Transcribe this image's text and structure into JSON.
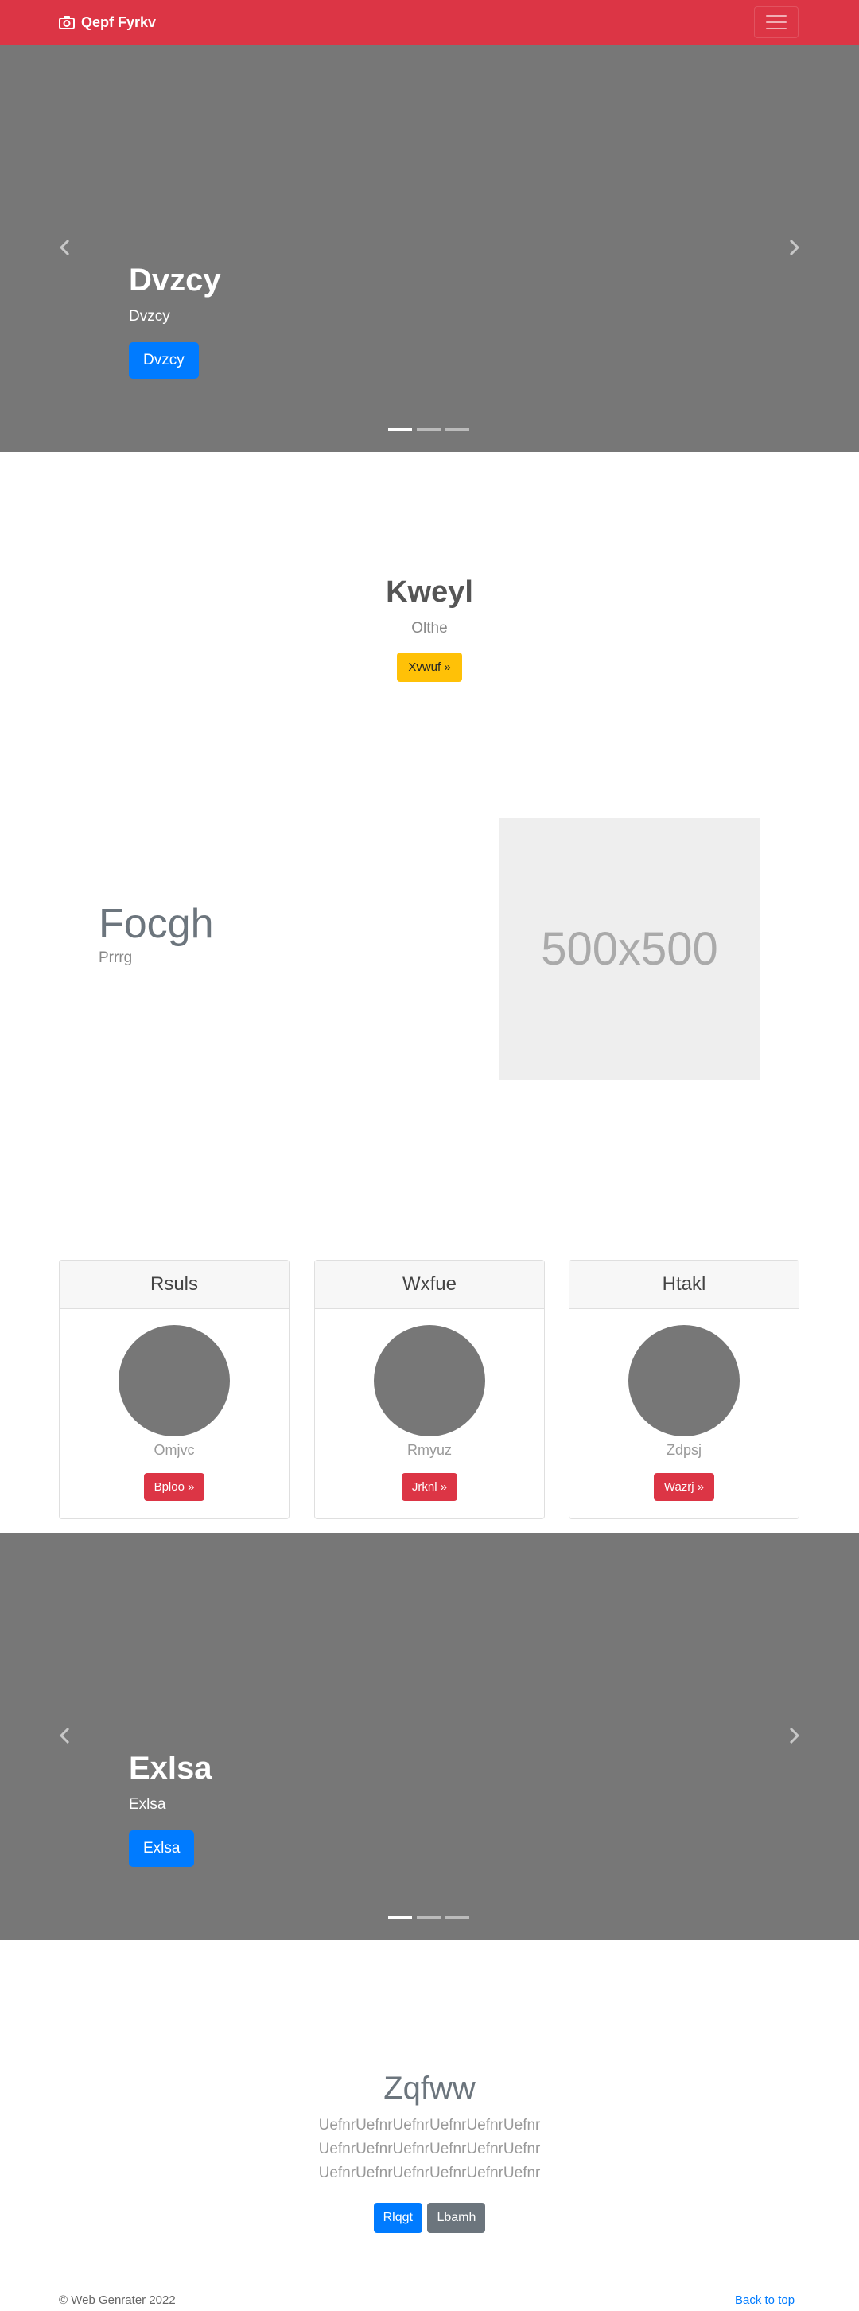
{
  "navbar": {
    "brand": "Qepf Fyrkv",
    "brand_icon": "camera-icon",
    "toggler_icon": "hamburger-icon",
    "bg_color": "#dc3545"
  },
  "carousel1": {
    "title": "Dvzcy",
    "text": "Dvzcy",
    "button": "Dvzcy"
  },
  "hero": {
    "title": "Kweyl",
    "text": "Olthe",
    "button": "Xvwuf »"
  },
  "feature": {
    "title": "Focgh",
    "text": "Prrrg",
    "image_label": "500x500"
  },
  "cards": [
    {
      "header": "Rsuls",
      "text": "Omjvc",
      "button": "Bploo »"
    },
    {
      "header": "Wxfue",
      "text": "Rmyuz",
      "button": "Jrknl »"
    },
    {
      "header": "Htakl",
      "text": "Zdpsj",
      "button": "Wazrj »"
    }
  ],
  "carousel2": {
    "title": "Exlsa",
    "text": "Exlsa",
    "button": "Exlsa"
  },
  "closing": {
    "title": "Zqfww",
    "text": "UefnrUefnrUefnrUefnrUefnrUefnr UefnrUefnrUefnrUefnrUefnrUefnr UefnrUefnrUefnrUefnrUefnrUefnr",
    "primary_button": "Rlqgt",
    "secondary_button": "Lbamh"
  },
  "footer": {
    "copyright": "© Web Genrater 2022",
    "back_to_top": "Back to top"
  }
}
